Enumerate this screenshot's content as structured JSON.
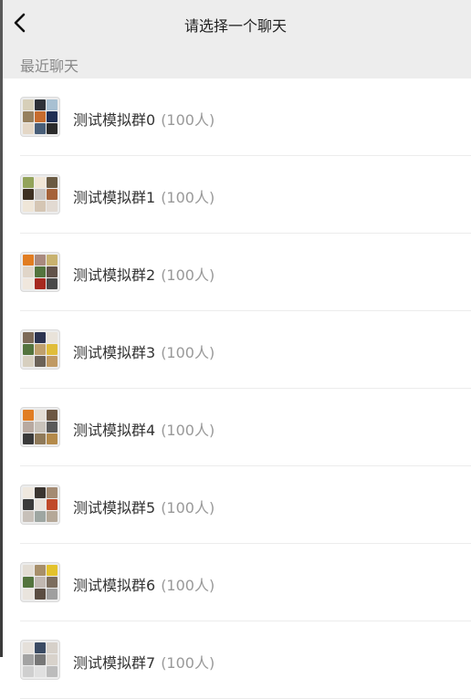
{
  "header": {
    "title": "请选择一个聊天",
    "back_icon": "chevron-left-icon"
  },
  "section": {
    "title": "最近聊天"
  },
  "chats": [
    {
      "name": "测试模拟群0",
      "count": "(100人)",
      "avatar_colors": [
        "#d7cfb9",
        "#2e3138",
        "#a8c0d2",
        "#96805e",
        "#c76c2d",
        "#1f2f54",
        "#e4d7c6",
        "#485e78",
        "#2b2b2b"
      ]
    },
    {
      "name": "测试模拟群1",
      "count": "(100人)",
      "avatar_colors": [
        "#93a35a",
        "#f1e6d6",
        "#6b5b43",
        "#3e3022",
        "#c8c2be",
        "#a56239",
        "#efe6d8",
        "#d5c6b4",
        "#e2dad2"
      ]
    },
    {
      "name": "测试模拟群2",
      "count": "(100人)",
      "avatar_colors": [
        "#e17d22",
        "#a98a7f",
        "#c8b26f",
        "#e0d5c8",
        "#54743e",
        "#62534a",
        "#f0e7dd",
        "#a6291f",
        "#4a4a4a"
      ]
    },
    {
      "name": "测试模拟群3",
      "count": "(100人)",
      "avatar_colors": [
        "#7d6a57",
        "#2d3450",
        "#e9e3da",
        "#54743e",
        "#bfa06e",
        "#e0bd3a",
        "#d7cfbf",
        "#6b6258",
        "#c09a64"
      ]
    },
    {
      "name": "测试模拟群4",
      "count": "(100人)",
      "avatar_colors": [
        "#e17d22",
        "#e4ddd3",
        "#6d5742",
        "#b8a9a0",
        "#c9c3bb",
        "#5a5a5a",
        "#3a3a3a",
        "#8f7a5a",
        "#b48a4a"
      ]
    },
    {
      "name": "测试模拟群5",
      "count": "(100人)",
      "avatar_colors": [
        "#efe8df",
        "#3b3530",
        "#a48b73",
        "#3a3a3a",
        "#e8e2db",
        "#c04a2a",
        "#c7c0b9",
        "#9ea6a2",
        "#b5a898"
      ]
    },
    {
      "name": "测试模拟群6",
      "count": "(100人)",
      "avatar_colors": [
        "#e3ddd4",
        "#a78f6a",
        "#e3c22c",
        "#54743e",
        "#c1b8b1",
        "#7c6e5f",
        "#e9e4dd",
        "#5b4d42",
        "#9f9f9f"
      ]
    },
    {
      "name": "测试模拟群7",
      "count": "(100人)",
      "avatar_colors": [
        "#e5e0da",
        "#3b4b63",
        "#d6d0c9",
        "#a3a3a3",
        "#777",
        "#d8d2cb",
        "#cfcfcf",
        "#e0e0e0",
        "#bcbcbc"
      ]
    }
  ]
}
